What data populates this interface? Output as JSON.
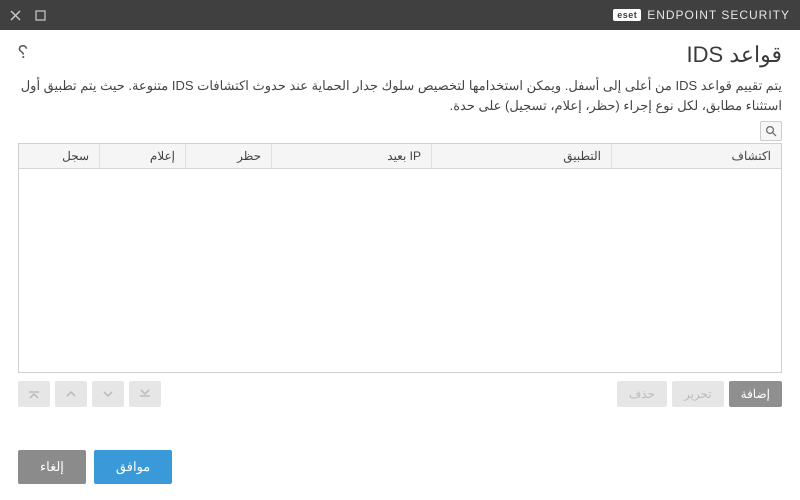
{
  "brand": {
    "badge": "eset",
    "name": "ENDPOINT SECURITY"
  },
  "page": {
    "title": "قواعد IDS",
    "description": "يتم تقييم قواعد IDS من أعلى إلى أسفل. ويمكن استخدامها لتخصيص سلوك جدار الحماية عند حدوث اكتشافات IDS متنوعة. حيث يتم تطبيق أول استثناء مطابق، لكل نوع إجراء (حظر، إعلام، تسجيل) على حدة."
  },
  "table": {
    "headers": {
      "detection": "اكتشاف",
      "application": "التطبيق",
      "remote_ip": "IP بعيد",
      "block": "حظر",
      "notify": "إعلام",
      "log": "سجل"
    },
    "rows": []
  },
  "actions": {
    "add": "إضافة",
    "edit": "تحرير",
    "delete": "حذف"
  },
  "footer": {
    "ok": "موافق",
    "cancel": "إلغاء"
  }
}
